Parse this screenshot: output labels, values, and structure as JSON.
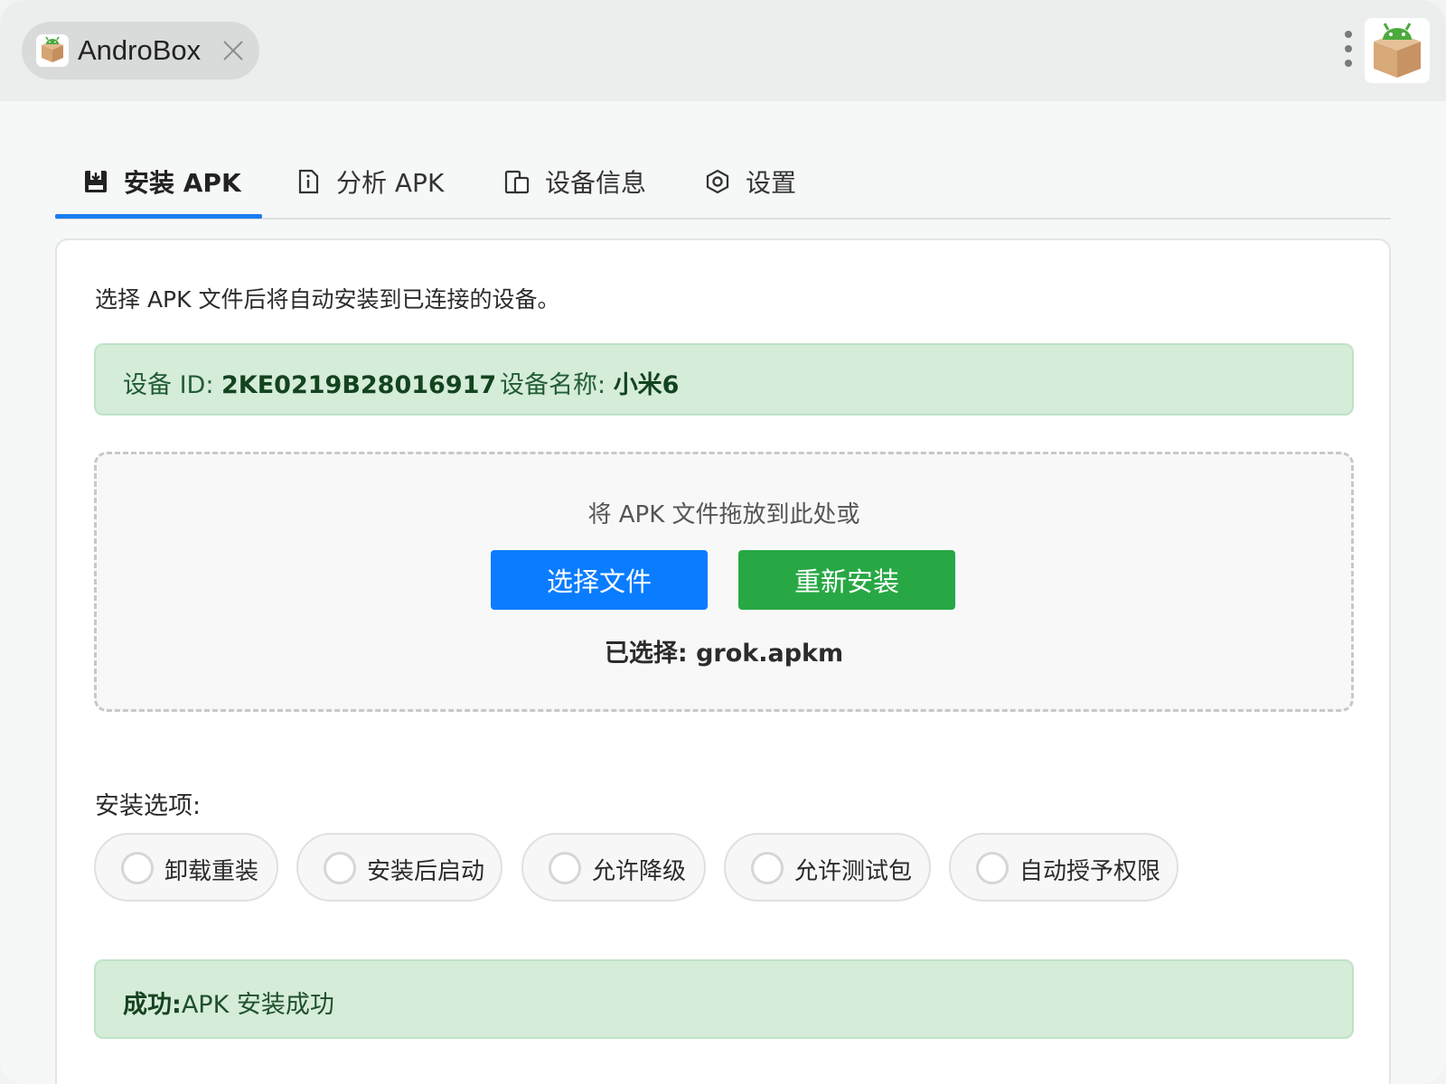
{
  "titlebar": {
    "app_title": "AndroBox",
    "close_icon": "close-icon",
    "menu_icon": "more-vertical-icon",
    "logo_icon": "android-box-icon"
  },
  "tabs": [
    {
      "label": "安装 APK",
      "icon": "install-icon",
      "active": true
    },
    {
      "label": "分析 APK",
      "icon": "file-info-icon",
      "active": false
    },
    {
      "label": "设备信息",
      "icon": "device-icon",
      "active": false
    },
    {
      "label": "设置",
      "icon": "settings-icon",
      "active": false
    }
  ],
  "install": {
    "intro": "选择 APK 文件后将自动安装到已连接的设备。",
    "device": {
      "id_label": "设备 ID: ",
      "id_value": "2KE0219B28016917",
      "name_label": "设备名称: ",
      "name_value": "小米6"
    },
    "dropzone": {
      "hint": "将 APK 文件拖放到此处或",
      "choose_button": "选择文件",
      "reinstall_button": "重新安装",
      "selected_label": "已选择: ",
      "selected_file": "grok.apkm"
    },
    "options_title": "安装选项:",
    "options": [
      {
        "label": "卸载重装",
        "checked": false
      },
      {
        "label": "安装后启动",
        "checked": false
      },
      {
        "label": "允许降级",
        "checked": false
      },
      {
        "label": "允许测试包",
        "checked": false
      },
      {
        "label": "自动授予权限",
        "checked": false
      }
    ],
    "result": {
      "prefix": "成功:",
      "text": "APK 安装成功"
    }
  },
  "colors": {
    "accent": "#1a7df2",
    "primary_button": "#0a7cff",
    "success_button": "#27a844",
    "success_bg": "#d5ecd9"
  }
}
